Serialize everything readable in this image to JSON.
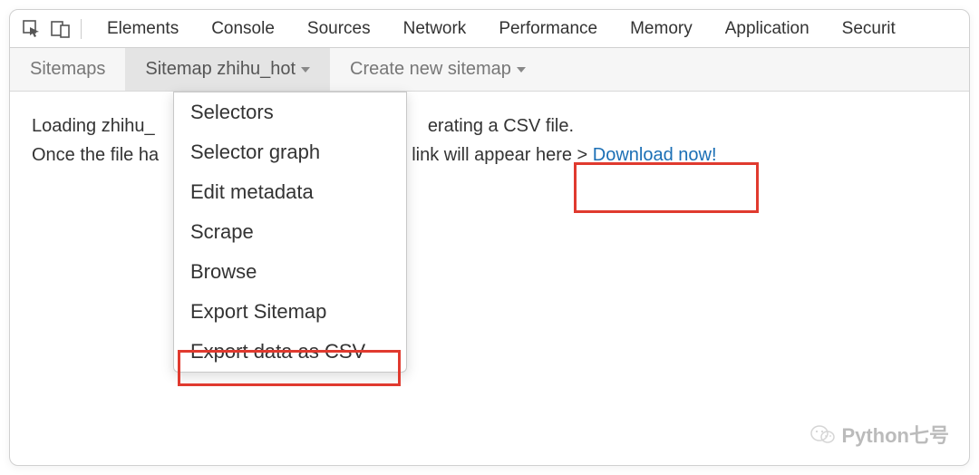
{
  "devtools": {
    "tabs": [
      "Elements",
      "Console",
      "Sources",
      "Network",
      "Performance",
      "Memory",
      "Application",
      "Securit"
    ]
  },
  "ext_bar": {
    "sitemaps": "Sitemaps",
    "sitemap_label": "Sitemap zhihu_hot",
    "create_label": "Create new sitemap"
  },
  "content": {
    "line1_a": "Loading zhihu_",
    "line1_b": "erating a CSV file.",
    "line2_a": "Once the file ha",
    "line2_b": "link will appear here >",
    "download": "Download now!"
  },
  "dropdown": {
    "items": [
      "Selectors",
      "Selector graph",
      "Edit metadata",
      "Scrape",
      "Browse",
      "Export Sitemap",
      "Export data as CSV"
    ]
  },
  "watermark": {
    "text": "Python七号"
  }
}
